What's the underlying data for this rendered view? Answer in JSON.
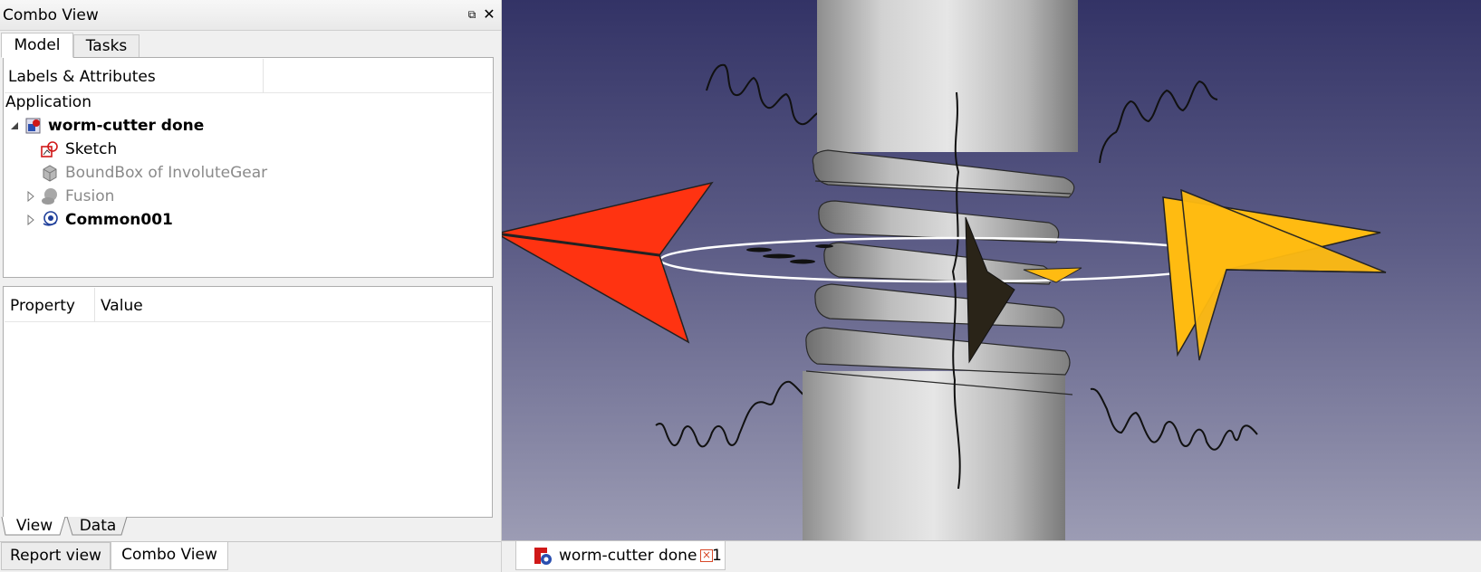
{
  "dock": {
    "title": "Combo View",
    "float_glyph": "⧉",
    "close_glyph": "✕"
  },
  "tabs": {
    "model": "Model",
    "tasks": "Tasks"
  },
  "tree": {
    "column_header": "Labels & Attributes",
    "section": "Application",
    "items": [
      {
        "label": "worm-cutter done",
        "icon": "document-icon",
        "bold": true,
        "color": "#000000"
      },
      {
        "label": "Sketch",
        "icon": "sketch-icon",
        "bold": false,
        "color": "#000000"
      },
      {
        "label": "BoundBox of InvoluteGear",
        "icon": "box-icon",
        "bold": false,
        "color": "#8a8a8a"
      },
      {
        "label": "Fusion",
        "icon": "fusion-icon",
        "bold": false,
        "color": "#8a8a8a"
      },
      {
        "label": "Common001",
        "icon": "common-icon",
        "bold": true,
        "color": "#000000"
      }
    ]
  },
  "properties": {
    "col_property": "Property",
    "col_value": "Value"
  },
  "view_data_tabs": {
    "view": "View",
    "data": "Data"
  },
  "bottom_tabs": {
    "report": "Report view",
    "combo": "Combo View"
  },
  "document_tab": {
    "label": "worm-cutter done : 1",
    "close_glyph": "×"
  },
  "colors": {
    "background_top": "#333366",
    "background_bottom": "#9c9cb4",
    "x_axis_arrow": "#ff3311",
    "y_axis_arrow": "#ffbb11",
    "worm_shaft": "#c8c8c8",
    "selection_ring": "#ffffff"
  }
}
